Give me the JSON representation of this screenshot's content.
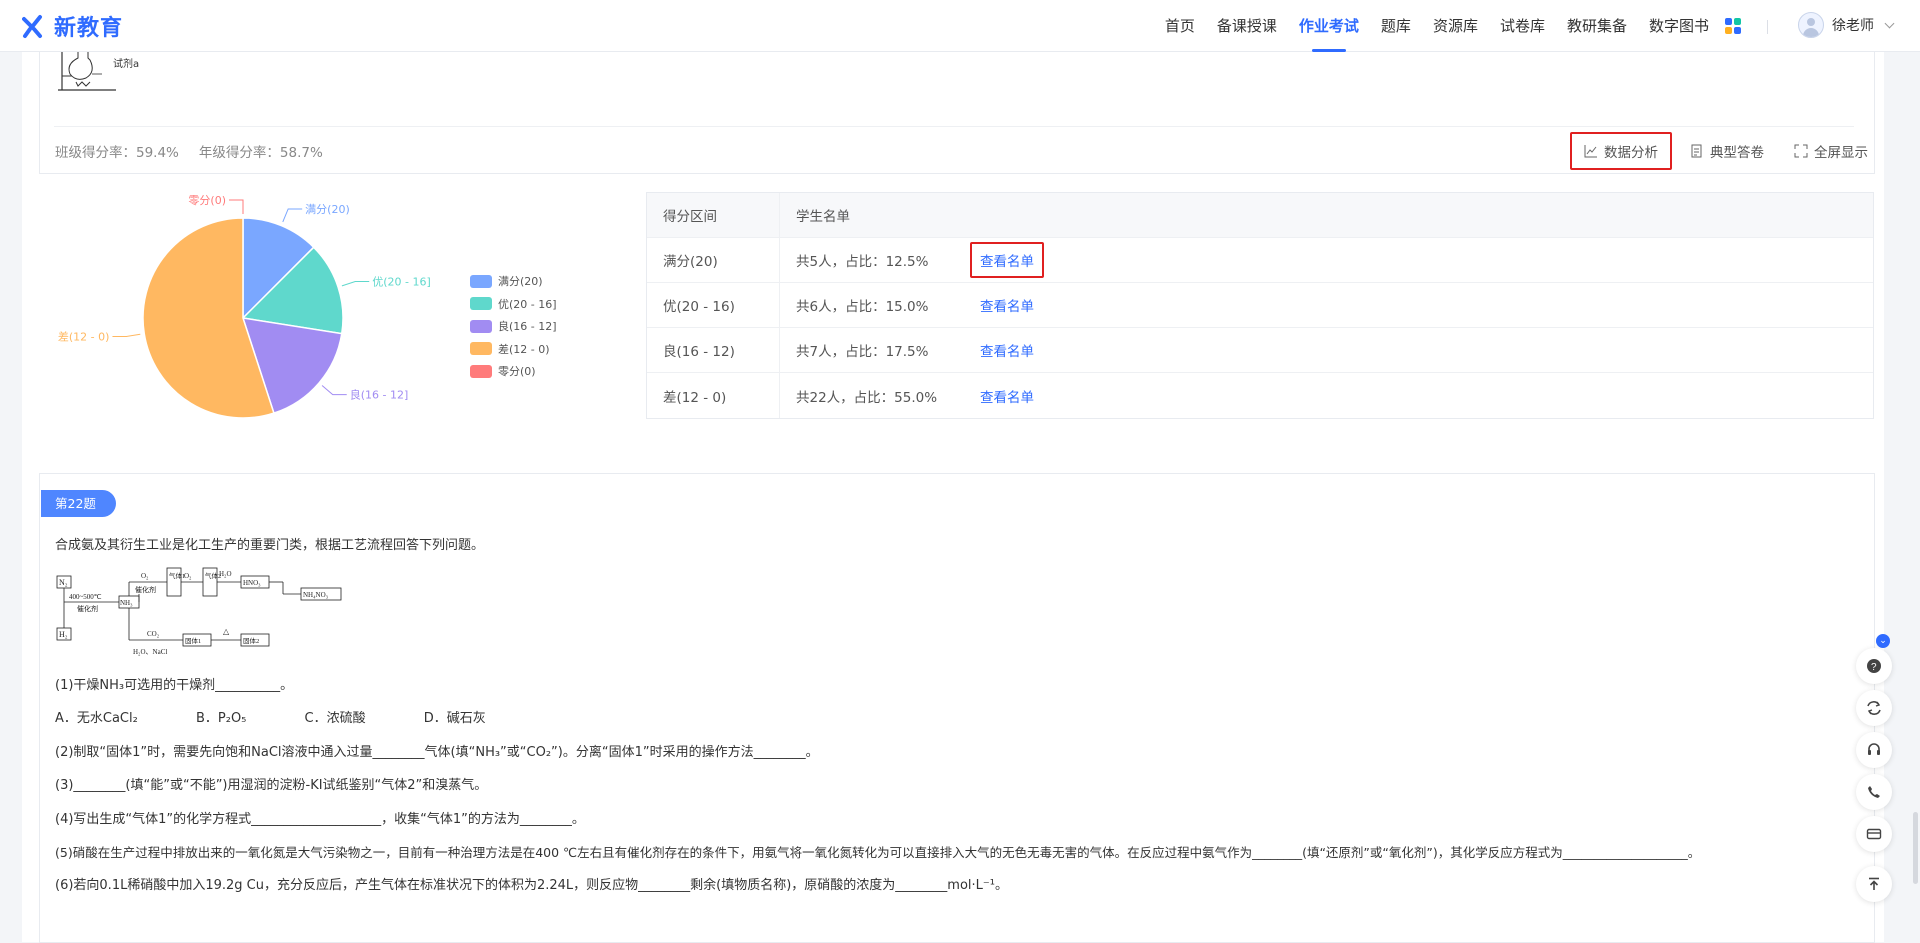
{
  "brand": {
    "logo_text": "新教育",
    "accent": "#2f6bff"
  },
  "nav": {
    "items": [
      {
        "label": "首页"
      },
      {
        "label": "备课授课"
      },
      {
        "label": "作业考试",
        "active": true
      },
      {
        "label": "题库"
      },
      {
        "label": "资源库"
      },
      {
        "label": "试卷库"
      },
      {
        "label": "教研集备"
      },
      {
        "label": "数字图书"
      }
    ],
    "user_name": "徐老师"
  },
  "question21": {
    "reagent_label": "试剂a",
    "class_rate": "班级得分率：59.4%",
    "grade_rate": "年级得分率：58.7%",
    "tools": {
      "analysis": "数据分析",
      "typical": "典型答卷",
      "fullscreen": "全屏显示"
    }
  },
  "chart_data": {
    "type": "pie",
    "categories": [
      "满分(20)",
      "优(20 - 16]",
      "良(16 - 12]",
      "差(12 - 0)",
      "零分(0)"
    ],
    "values": [
      5,
      6,
      7,
      22,
      0
    ],
    "percent": [
      12.5,
      15.0,
      17.5,
      55.0,
      0
    ],
    "colors": [
      "#7aa7ff",
      "#5fd8cc",
      "#a18cf2",
      "#ffb861",
      "#ff7b7b"
    ],
    "legend_placement": "right",
    "slice_labels": [
      "满分(20)",
      "优(20 - 16]",
      "良(16 - 12]",
      "差(12 - 0)",
      "零分(0)"
    ]
  },
  "score_table": {
    "headers": [
      "得分区间",
      "学生名单"
    ],
    "rows": [
      {
        "range": "满分(20)",
        "summary": "共5人，占比：12.5%",
        "link": "查看名单"
      },
      {
        "range": "优(20 - 16)",
        "summary": "共6人，占比：15.0%",
        "link": "查看名单"
      },
      {
        "range": "良(16 - 12)",
        "summary": "共7人，占比：17.5%",
        "link": "查看名单"
      },
      {
        "range": "差(12 - 0)",
        "summary": "共22人，占比：55.0%",
        "link": "查看名单"
      }
    ]
  },
  "question22": {
    "badge": "第22题",
    "stem": "合成氨及其衍生工业是化工生产的重要门类，根据工艺流程回答下列问题。",
    "diagram": {
      "n2": "N₂",
      "h2": "H₂",
      "cond": "400~500℃",
      "cat": "催化剂",
      "nh3": "NH₃",
      "o2a": "O₂",
      "cat2": "催化剂",
      "gas1": "气体1",
      "o2b": "O₂",
      "gas2": "气体2",
      "h2o": "H₂O",
      "hno3": "HNO₃",
      "nh4no3": "NH₄NO₃",
      "co2": "CO₂",
      "salt": "H₂O、NaCl",
      "solid1": "固体1",
      "heat": "△",
      "solid2": "固体2"
    },
    "q1": "(1)干燥NH₃可选用的干燥剂__________。",
    "options": [
      "A．无水CaCl₂",
      "B．P₂O₅",
      "C．浓硫酸",
      "D．碱石灰"
    ],
    "q2": "(2)制取“固体1”时，需要先向饱和NaCl溶液中通入过量________气体(填“NH₃”或“CO₂”)。分离“固体1”时采用的操作方法________。",
    "q3": "(3)________(填“能”或“不能”)用湿润的淀粉-KI试纸鉴别“气体2”和溴蒸气。",
    "q4": "(4)写出生成“气体1”的化学方程式____________________，收集“气体1”的方法为________。",
    "q5": "(5)硝酸在生产过程中排放出来的一氧化氮是大气污染物之一，目前有一种治理方法是在400 ℃左右且有催化剂存在的条件下，用氨气将一氧化氮转化为可以直接排入大气的无色无毒无害的气体。在反应过程中氨气作为________(填“还原剂”或“氧化剂”)，其化学反应方程式为____________________。",
    "q6": "(6)若向0.1L稀硝酸中加入19.2g Cu，充分反应后，产生气体在标准状况下的体积为2.24L，则反应物________剩余(填物质名称)，原硝酸的浓度为________mol·L⁻¹。"
  },
  "side_tools": [
    "help-icon",
    "refresh-icon",
    "headset-icon",
    "phone-icon",
    "card-icon",
    "back-to-top-icon"
  ]
}
